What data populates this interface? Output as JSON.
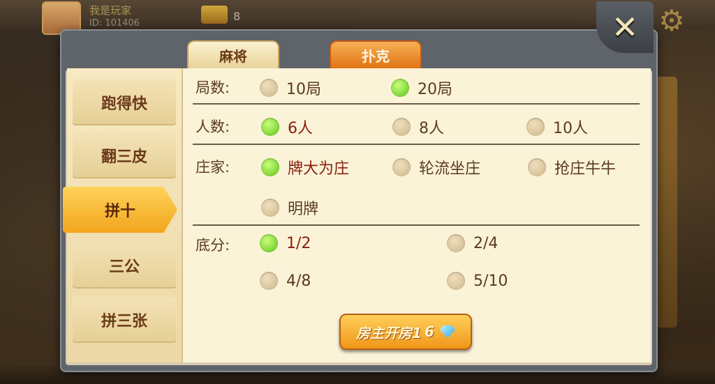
{
  "background": {
    "player_name": "我是玩家",
    "player_id": "ID: 101406",
    "coin_count": "8"
  },
  "tabs": [
    {
      "label": "麻将",
      "active": false
    },
    {
      "label": "扑克",
      "active": true
    }
  ],
  "close_icon": "close-icon",
  "nav": [
    {
      "label": "跑得快",
      "active": false
    },
    {
      "label": "翻三皮",
      "active": false
    },
    {
      "label": "拼十",
      "active": true
    },
    {
      "label": "三公",
      "active": false
    },
    {
      "label": "拼三张",
      "active": false
    }
  ],
  "rounds": {
    "label": "局数:",
    "options": [
      {
        "label": "10局",
        "selected": false
      },
      {
        "label": "20局",
        "selected": true
      }
    ]
  },
  "players": {
    "label": "人数:",
    "options": [
      {
        "label": "6人",
        "selected": true
      },
      {
        "label": "8人",
        "selected": false
      },
      {
        "label": "10人",
        "selected": false
      }
    ]
  },
  "banker": {
    "label": "庄家:",
    "options": [
      {
        "label": "牌大为庄",
        "selected": true
      },
      {
        "label": "轮流坐庄",
        "selected": false
      },
      {
        "label": "抢庄牛牛",
        "selected": false
      },
      {
        "label": "明牌",
        "selected": false
      }
    ]
  },
  "base_score": {
    "label": "底分:",
    "options": [
      {
        "label": "1/2",
        "selected": true
      },
      {
        "label": "2/4",
        "selected": false
      },
      {
        "label": "4/8",
        "selected": false
      },
      {
        "label": "5/10",
        "selected": false
      }
    ]
  },
  "create_button": {
    "label": "房主开房1",
    "cost": "6",
    "icon": "diamond-icon"
  },
  "colors": {
    "radio_selected": "#5ec21c",
    "tab_active": "#e07412",
    "nav_active": "#f2a51c"
  }
}
